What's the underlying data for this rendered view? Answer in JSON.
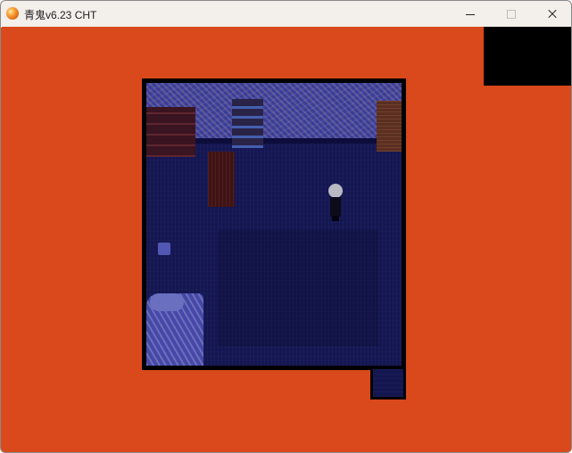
{
  "window": {
    "title": "青鬼v6.23 CHT",
    "app_icon": "orange-sphere-icon",
    "controls": {
      "minimize_icon": "minimize-icon",
      "maximize_icon": "maximize-icon",
      "close_icon": "close-icon"
    }
  },
  "game": {
    "background_color": "#d9491b",
    "scene": "bedroom",
    "floor_color": "#141650",
    "wall_color": "#3b3c94"
  }
}
